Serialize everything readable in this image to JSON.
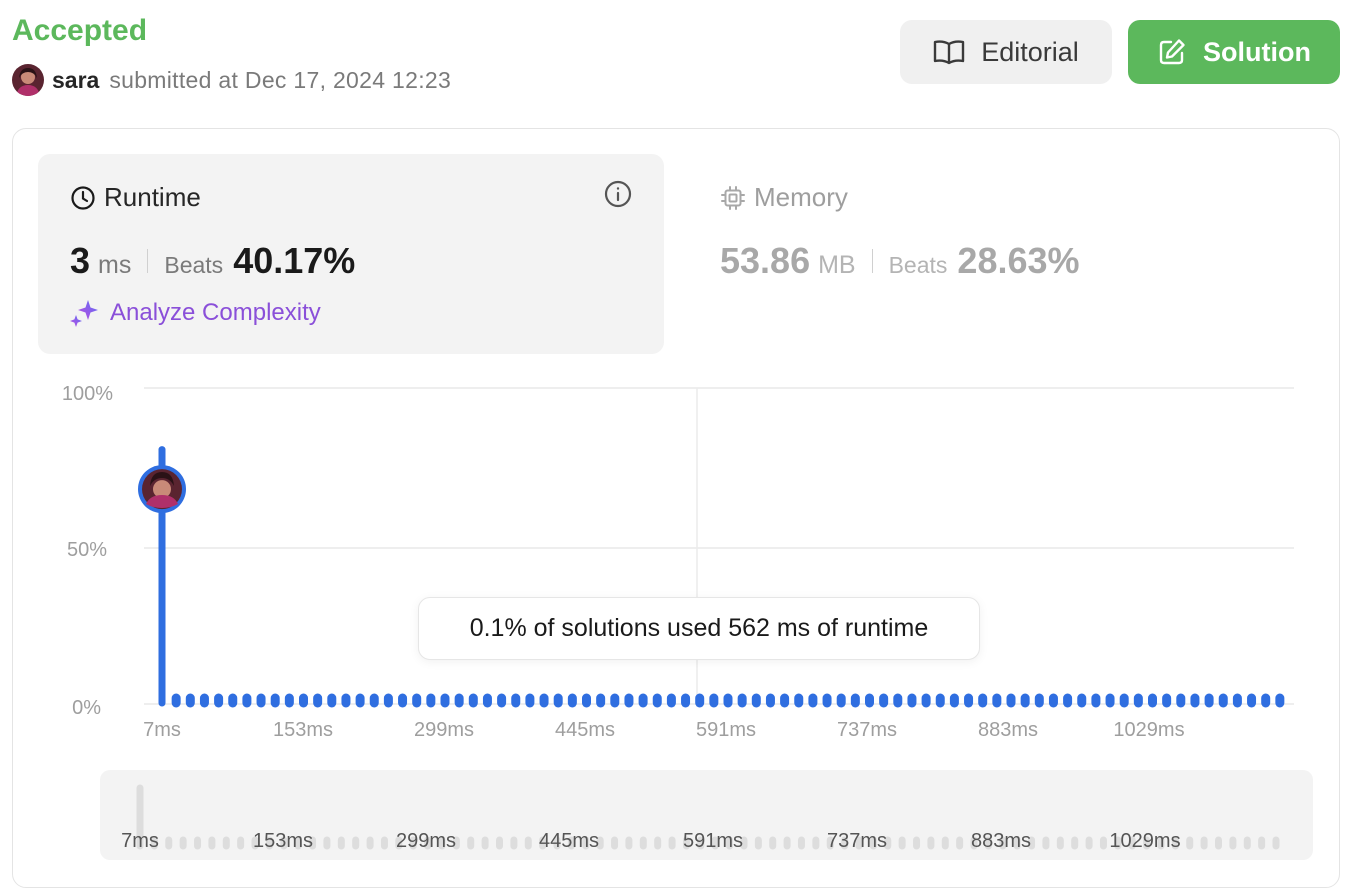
{
  "header": {
    "status": "Accepted",
    "username": "sara",
    "submitted_text": "submitted at Dec 17, 2024 12:23",
    "editorial_label": "Editorial",
    "solution_label": "Solution",
    "colors": {
      "accepted": "#5cb85c",
      "solution_button": "#5cb85c"
    }
  },
  "runtime": {
    "title": "Runtime",
    "value": "3",
    "unit": "ms",
    "beats_label": "Beats",
    "beats_value": "40.17%",
    "analyze_label": "Analyze Complexity",
    "icons": [
      "clock-icon",
      "info-icon",
      "sparkle-icon"
    ]
  },
  "memory": {
    "title": "Memory",
    "value": "53.86",
    "unit": "MB",
    "beats_label": "Beats",
    "beats_value": "28.63%",
    "icons": [
      "cpu-chip-icon"
    ]
  },
  "tooltip": {
    "text": "0.1% of solutions used 562 ms of runtime"
  },
  "chart_data": {
    "type": "bar",
    "y_tick_labels": [
      "100%",
      "50%",
      "0%"
    ],
    "ylim": [
      0,
      100
    ],
    "x_tick_labels": [
      "7ms",
      "153ms",
      "299ms",
      "445ms",
      "591ms",
      "737ms",
      "883ms",
      "1029ms"
    ],
    "bar_count": 80,
    "values": [
      80.5,
      0.1,
      0.1,
      0.1,
      0.1,
      0.1,
      0.1,
      0.1,
      0.1,
      0.1,
      0.1,
      0.1,
      0.1,
      0.1,
      0.1,
      0.1,
      0.1,
      0.1,
      0.1,
      0.1,
      0.1,
      0.1,
      0.1,
      0.1,
      0.1,
      0.1,
      0.1,
      0.1,
      0.1,
      0.1,
      0.1,
      0.1,
      0.1,
      0.1,
      0.1,
      0.1,
      0.1,
      0.1,
      0.1,
      0.1,
      0.1,
      0.1,
      0.1,
      0.1,
      0.1,
      0.1,
      0.1,
      0.1,
      0.1,
      0.1,
      0.1,
      0.1,
      0.1,
      0.1,
      0.1,
      0.1,
      0.1,
      0.1,
      0.1,
      0.1,
      0.1,
      0.1,
      0.1,
      0.1,
      0.1,
      0.1,
      0.1,
      0.1,
      0.1,
      0.1,
      0.1,
      0.1,
      0.1,
      0.1,
      0.1,
      0.1,
      0.1,
      0.1,
      0.1,
      0.1
    ],
    "user_bar_index": 0,
    "user_marker_value": 68,
    "bar_color": "#2f6ee0",
    "scrubber_bar_color": "#dddddd",
    "grid": true
  }
}
